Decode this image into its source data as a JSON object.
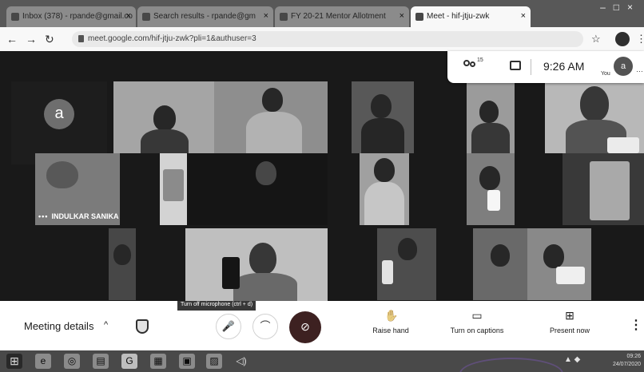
{
  "browser": {
    "tabs": [
      {
        "title": "Inbox (378) - rpande@gmail.co"
      },
      {
        "title": "Search results - rpande@gm"
      },
      {
        "title": "FY 20-21 Mentor Allotment"
      },
      {
        "title": "Meet - hif-jtju-zwk"
      }
    ],
    "url": "meet.google.com/hif-jtju-zwk?pli=1&authuser=3"
  },
  "meeting": {
    "participant_initial": "a",
    "name_label": "INDULKAR SANIKA",
    "participant_count": "15",
    "time": "9:26 AM",
    "self_label": "You",
    "self_initial": "a"
  },
  "controls": {
    "details_label": "Meeting details",
    "tooltip": "Turn off microphone (ctrl + d)",
    "raise_hand": "Raise hand",
    "captions": "Turn on captions",
    "present": "Present now"
  },
  "taskbar": {
    "clock_time": "09:26",
    "clock_date": "24/07/2020"
  },
  "icons": [
    "back-icon",
    "forward-icon",
    "reload-icon",
    "lock-icon",
    "star-icon",
    "people-icon",
    "chat-icon",
    "shield-icon",
    "mic-icon",
    "hangup-icon",
    "camera-off-icon",
    "hand-icon",
    "captions-icon",
    "present-icon",
    "more-icon"
  ],
  "colors": {
    "hangup": "#5b1e1e",
    "bar": "#fbfbfb",
    "taskbar": "#4c4c4c"
  }
}
